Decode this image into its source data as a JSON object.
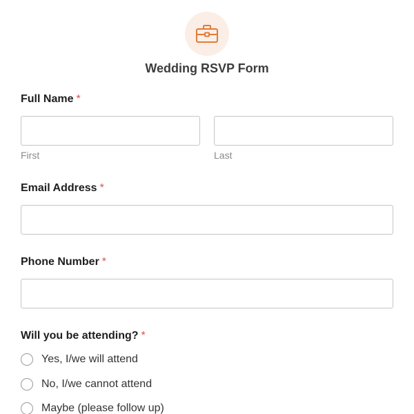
{
  "form": {
    "icon": "briefcase-icon",
    "accent_color": "#e07b39",
    "icon_bg_color": "#fbeee6",
    "title": "Wedding RSVP Form"
  },
  "fields": {
    "full_name": {
      "label": "Full Name",
      "required_mark": "*",
      "first": {
        "value": "",
        "sublabel": "First"
      },
      "last": {
        "value": "",
        "sublabel": "Last"
      }
    },
    "email": {
      "label": "Email Address",
      "required_mark": "*",
      "value": ""
    },
    "phone": {
      "label": "Phone Number",
      "required_mark": "*",
      "value": ""
    },
    "attending": {
      "label": "Will you be attending?",
      "required_mark": "*",
      "options": [
        {
          "label": "Yes, I/we will attend",
          "selected": false
        },
        {
          "label": "No, I/we cannot attend",
          "selected": false
        },
        {
          "label": "Maybe (please follow up)",
          "selected": false
        }
      ]
    }
  }
}
